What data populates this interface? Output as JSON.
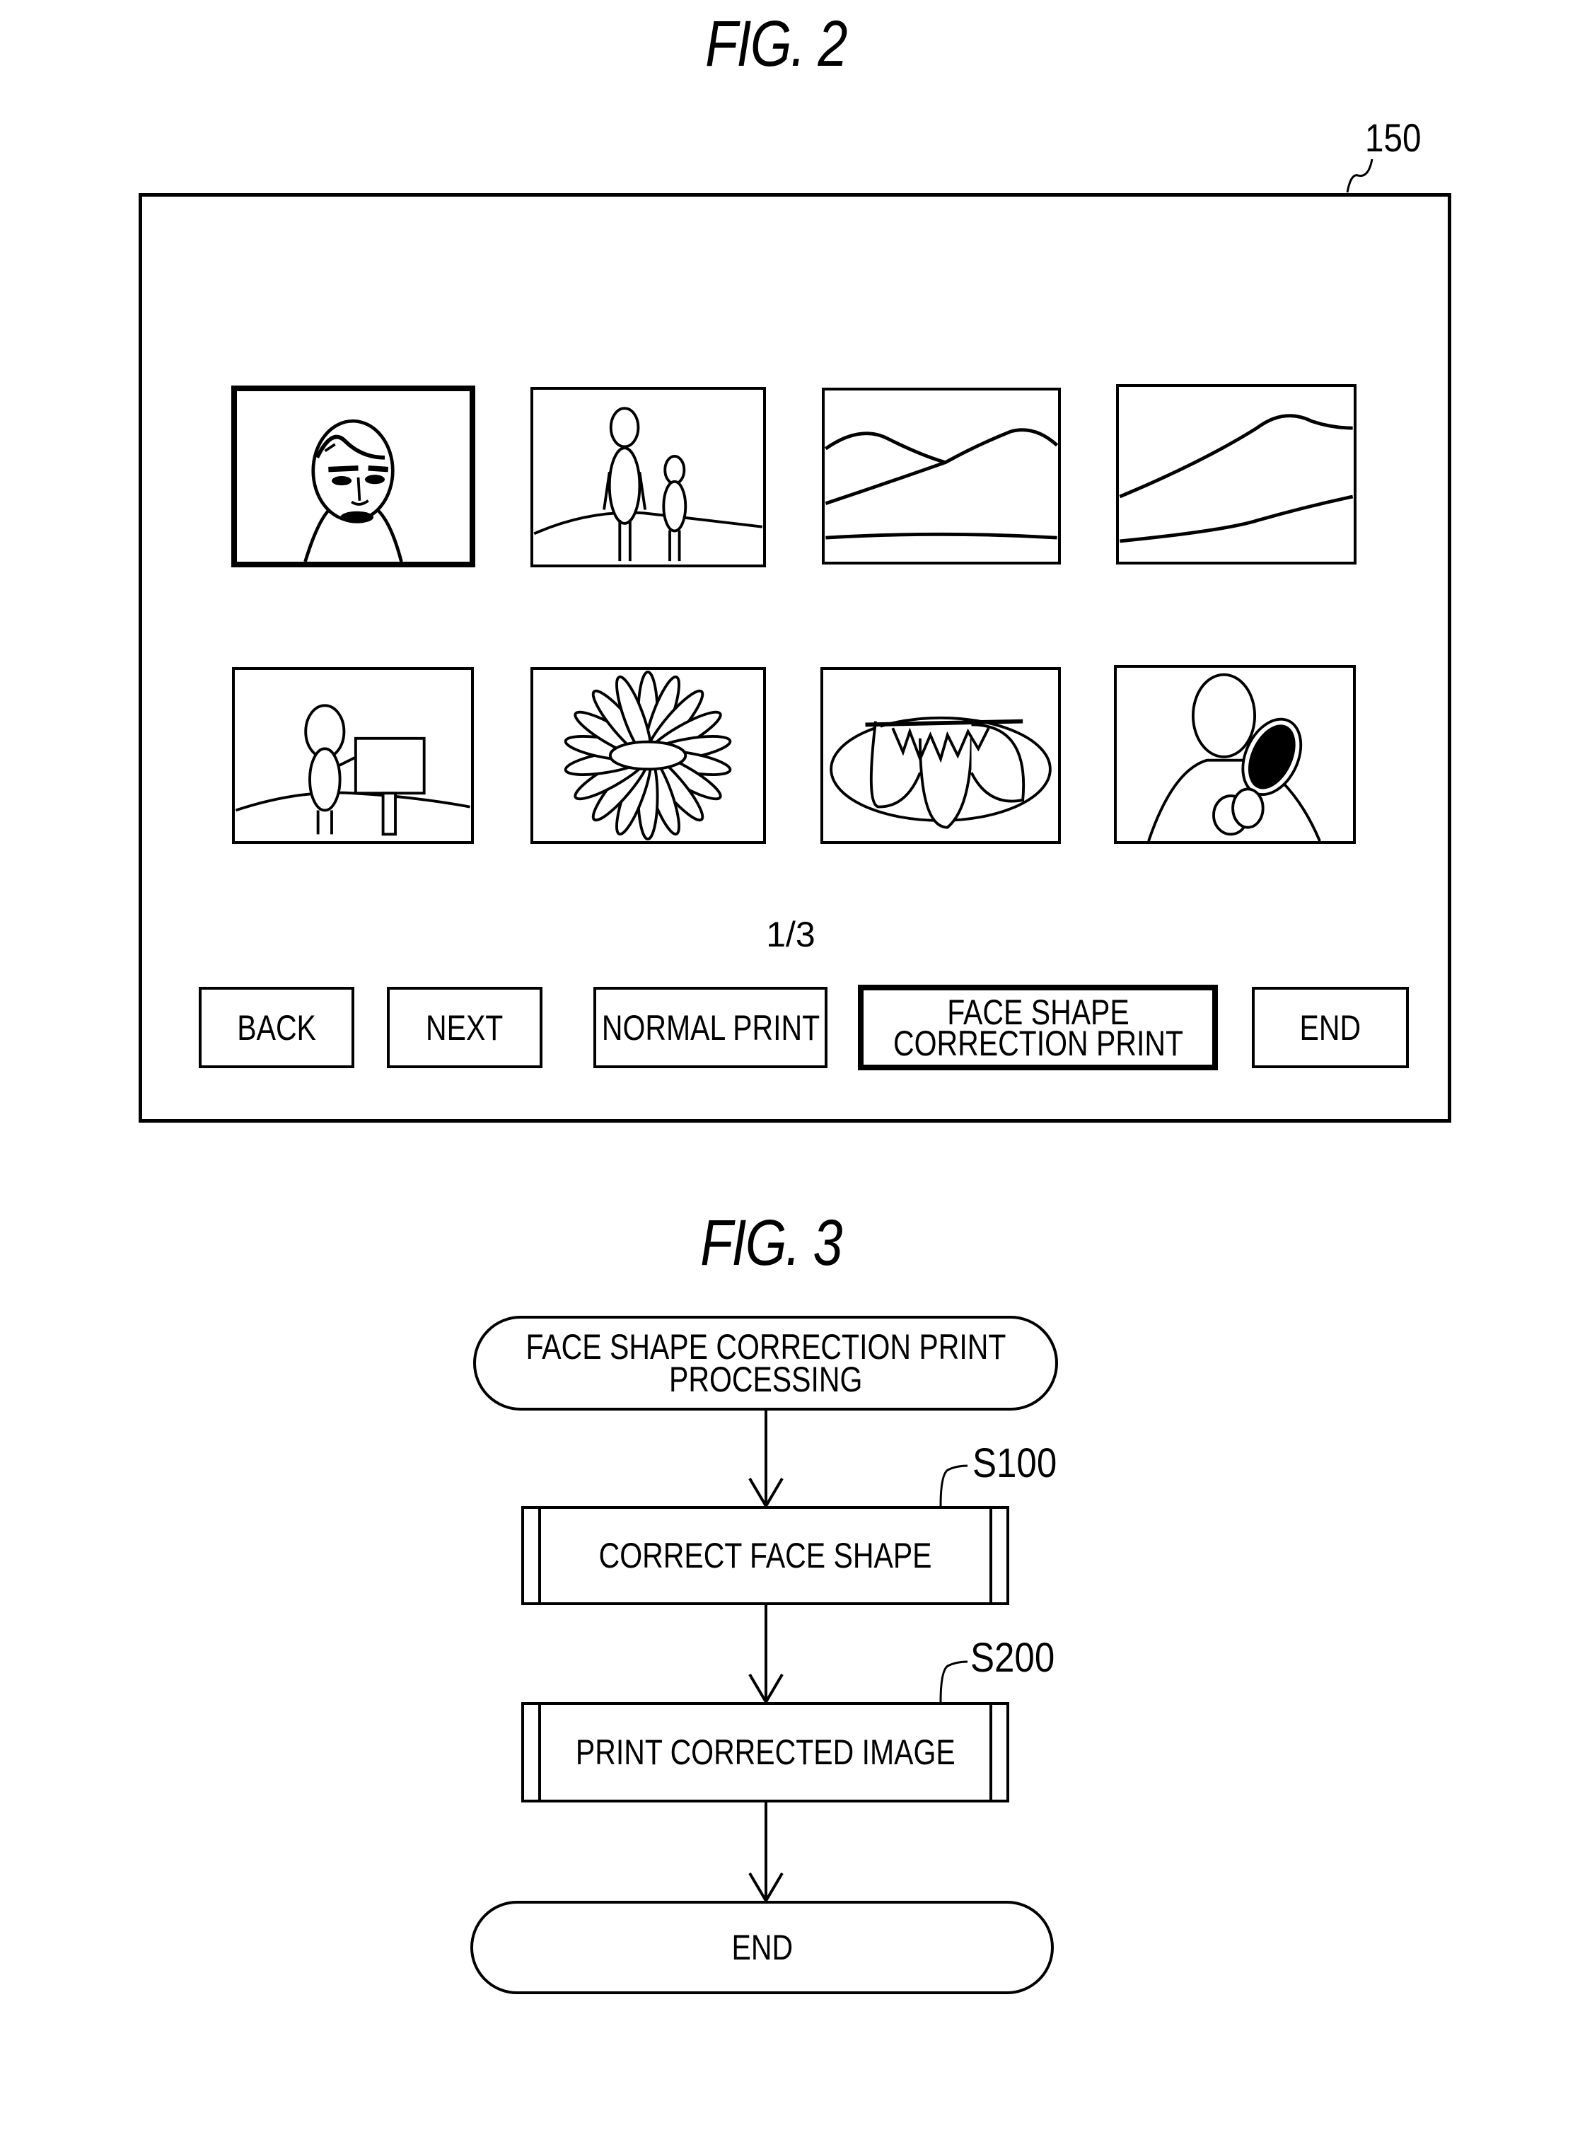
{
  "fig2": {
    "title": "FIG. 2",
    "ref_label": "150",
    "thumbnails": [
      {
        "name": "portrait-face",
        "selected": true
      },
      {
        "name": "two-people-on-hill",
        "selected": false
      },
      {
        "name": "mountains-landscape",
        "selected": false
      },
      {
        "name": "hill-landscape",
        "selected": false
      },
      {
        "name": "person-with-signpost",
        "selected": false
      },
      {
        "name": "flower",
        "selected": false
      },
      {
        "name": "strawberries-on-plate",
        "selected": false
      },
      {
        "name": "tennis-player",
        "selected": false
      }
    ],
    "page_indicator": "1/3",
    "buttons": {
      "back": "BACK",
      "next": "NEXT",
      "normal_print": "NORMAL PRINT",
      "face_shape_line1": "FACE SHAPE",
      "face_shape_line2": "CORRECTION PRINT",
      "end": "END"
    }
  },
  "fig3": {
    "title": "FIG. 3",
    "start_line1": "FACE SHAPE CORRECTION PRINT",
    "start_line2": "PROCESSING",
    "steps": [
      {
        "id": "S100",
        "label": "CORRECT FACE SHAPE"
      },
      {
        "id": "S200",
        "label": "PRINT CORRECTED IMAGE"
      }
    ],
    "end": "END"
  }
}
